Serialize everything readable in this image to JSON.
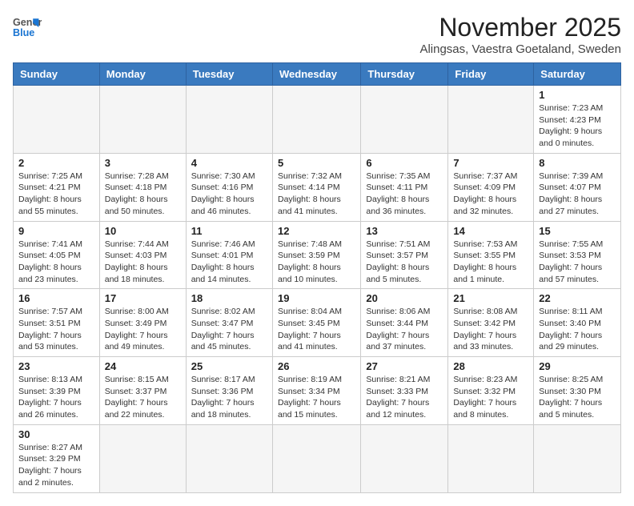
{
  "header": {
    "logo_general": "General",
    "logo_blue": "Blue",
    "month_title": "November 2025",
    "location": "Alingsas, Vaestra Goetaland, Sweden"
  },
  "weekdays": [
    "Sunday",
    "Monday",
    "Tuesday",
    "Wednesday",
    "Thursday",
    "Friday",
    "Saturday"
  ],
  "weeks": [
    [
      {
        "day": "",
        "info": ""
      },
      {
        "day": "",
        "info": ""
      },
      {
        "day": "",
        "info": ""
      },
      {
        "day": "",
        "info": ""
      },
      {
        "day": "",
        "info": ""
      },
      {
        "day": "",
        "info": ""
      },
      {
        "day": "1",
        "info": "Sunrise: 7:23 AM\nSunset: 4:23 PM\nDaylight: 9 hours\nand 0 minutes."
      }
    ],
    [
      {
        "day": "2",
        "info": "Sunrise: 7:25 AM\nSunset: 4:21 PM\nDaylight: 8 hours\nand 55 minutes."
      },
      {
        "day": "3",
        "info": "Sunrise: 7:28 AM\nSunset: 4:18 PM\nDaylight: 8 hours\nand 50 minutes."
      },
      {
        "day": "4",
        "info": "Sunrise: 7:30 AM\nSunset: 4:16 PM\nDaylight: 8 hours\nand 46 minutes."
      },
      {
        "day": "5",
        "info": "Sunrise: 7:32 AM\nSunset: 4:14 PM\nDaylight: 8 hours\nand 41 minutes."
      },
      {
        "day": "6",
        "info": "Sunrise: 7:35 AM\nSunset: 4:11 PM\nDaylight: 8 hours\nand 36 minutes."
      },
      {
        "day": "7",
        "info": "Sunrise: 7:37 AM\nSunset: 4:09 PM\nDaylight: 8 hours\nand 32 minutes."
      },
      {
        "day": "8",
        "info": "Sunrise: 7:39 AM\nSunset: 4:07 PM\nDaylight: 8 hours\nand 27 minutes."
      }
    ],
    [
      {
        "day": "9",
        "info": "Sunrise: 7:41 AM\nSunset: 4:05 PM\nDaylight: 8 hours\nand 23 minutes."
      },
      {
        "day": "10",
        "info": "Sunrise: 7:44 AM\nSunset: 4:03 PM\nDaylight: 8 hours\nand 18 minutes."
      },
      {
        "day": "11",
        "info": "Sunrise: 7:46 AM\nSunset: 4:01 PM\nDaylight: 8 hours\nand 14 minutes."
      },
      {
        "day": "12",
        "info": "Sunrise: 7:48 AM\nSunset: 3:59 PM\nDaylight: 8 hours\nand 10 minutes."
      },
      {
        "day": "13",
        "info": "Sunrise: 7:51 AM\nSunset: 3:57 PM\nDaylight: 8 hours\nand 5 minutes."
      },
      {
        "day": "14",
        "info": "Sunrise: 7:53 AM\nSunset: 3:55 PM\nDaylight: 8 hours\nand 1 minute."
      },
      {
        "day": "15",
        "info": "Sunrise: 7:55 AM\nSunset: 3:53 PM\nDaylight: 7 hours\nand 57 minutes."
      }
    ],
    [
      {
        "day": "16",
        "info": "Sunrise: 7:57 AM\nSunset: 3:51 PM\nDaylight: 7 hours\nand 53 minutes."
      },
      {
        "day": "17",
        "info": "Sunrise: 8:00 AM\nSunset: 3:49 PM\nDaylight: 7 hours\nand 49 minutes."
      },
      {
        "day": "18",
        "info": "Sunrise: 8:02 AM\nSunset: 3:47 PM\nDaylight: 7 hours\nand 45 minutes."
      },
      {
        "day": "19",
        "info": "Sunrise: 8:04 AM\nSunset: 3:45 PM\nDaylight: 7 hours\nand 41 minutes."
      },
      {
        "day": "20",
        "info": "Sunrise: 8:06 AM\nSunset: 3:44 PM\nDaylight: 7 hours\nand 37 minutes."
      },
      {
        "day": "21",
        "info": "Sunrise: 8:08 AM\nSunset: 3:42 PM\nDaylight: 7 hours\nand 33 minutes."
      },
      {
        "day": "22",
        "info": "Sunrise: 8:11 AM\nSunset: 3:40 PM\nDaylight: 7 hours\nand 29 minutes."
      }
    ],
    [
      {
        "day": "23",
        "info": "Sunrise: 8:13 AM\nSunset: 3:39 PM\nDaylight: 7 hours\nand 26 minutes."
      },
      {
        "day": "24",
        "info": "Sunrise: 8:15 AM\nSunset: 3:37 PM\nDaylight: 7 hours\nand 22 minutes."
      },
      {
        "day": "25",
        "info": "Sunrise: 8:17 AM\nSunset: 3:36 PM\nDaylight: 7 hours\nand 18 minutes."
      },
      {
        "day": "26",
        "info": "Sunrise: 8:19 AM\nSunset: 3:34 PM\nDaylight: 7 hours\nand 15 minutes."
      },
      {
        "day": "27",
        "info": "Sunrise: 8:21 AM\nSunset: 3:33 PM\nDaylight: 7 hours\nand 12 minutes."
      },
      {
        "day": "28",
        "info": "Sunrise: 8:23 AM\nSunset: 3:32 PM\nDaylight: 7 hours\nand 8 minutes."
      },
      {
        "day": "29",
        "info": "Sunrise: 8:25 AM\nSunset: 3:30 PM\nDaylight: 7 hours\nand 5 minutes."
      }
    ],
    [
      {
        "day": "30",
        "info": "Sunrise: 8:27 AM\nSunset: 3:29 PM\nDaylight: 7 hours\nand 2 minutes."
      },
      {
        "day": "",
        "info": ""
      },
      {
        "day": "",
        "info": ""
      },
      {
        "day": "",
        "info": ""
      },
      {
        "day": "",
        "info": ""
      },
      {
        "day": "",
        "info": ""
      },
      {
        "day": "",
        "info": ""
      }
    ]
  ]
}
